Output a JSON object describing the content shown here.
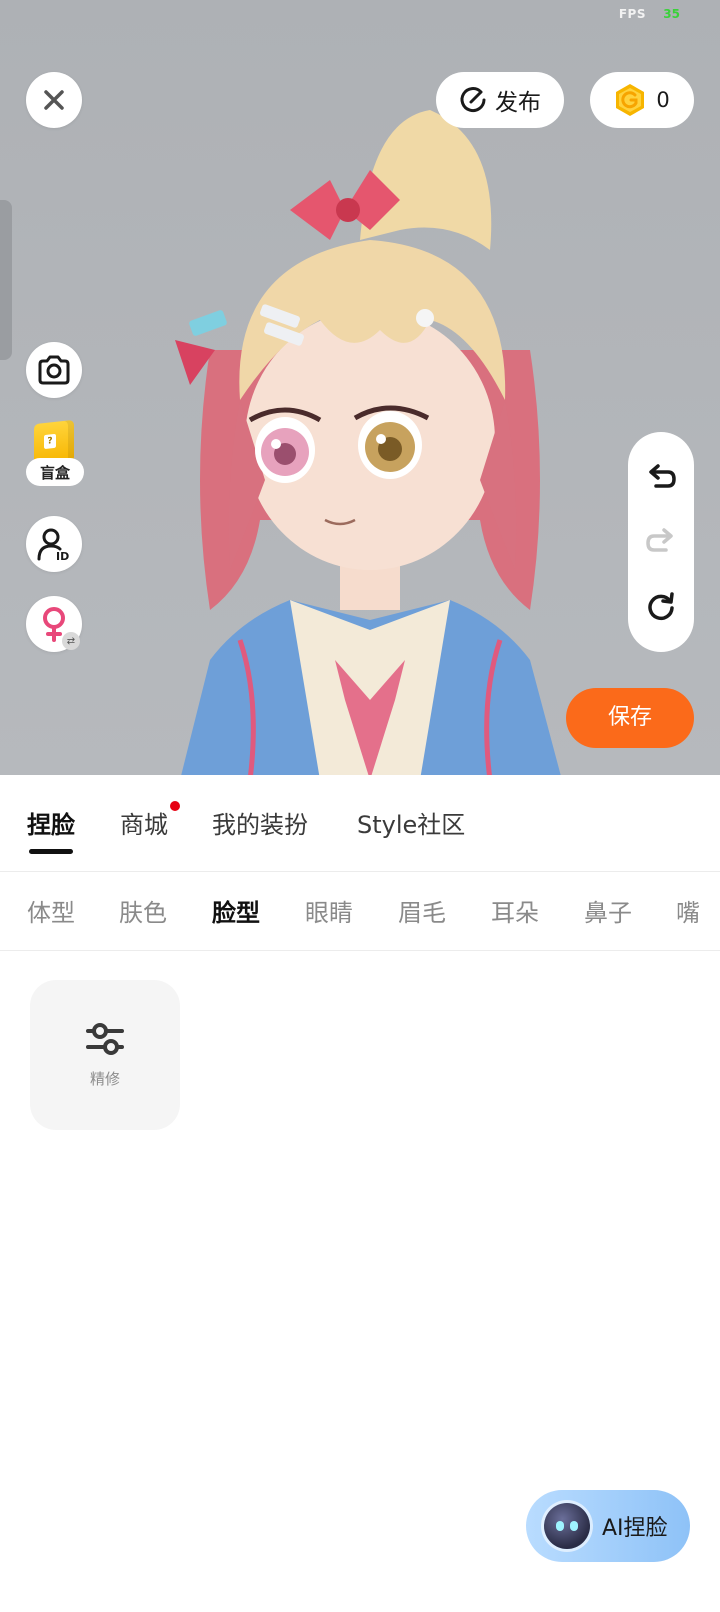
{
  "status": {
    "fps_label": "FPS",
    "fps_value": "35"
  },
  "top_bar": {
    "close_icon": "close-icon",
    "publish_label": "发布",
    "publish_icon": "publish-icon",
    "coin_count": "0",
    "coin_icon": "coin-icon"
  },
  "left_tools": {
    "camera_icon": "camera-icon",
    "blindbox_label": "盲盒",
    "id_icon": "user-id-icon",
    "gender_icon": "female-icon"
  },
  "history": {
    "undo_icon": "undo-icon",
    "redo_icon": "redo-icon",
    "reset_icon": "reset-icon"
  },
  "save_label": "保存",
  "main_tabs": [
    {
      "label": "捏脸",
      "active": true
    },
    {
      "label": "商城",
      "badge": true
    },
    {
      "label": "我的装扮"
    },
    {
      "label": "Style社区"
    }
  ],
  "sub_tabs": [
    {
      "label": "体型"
    },
    {
      "label": "肤色"
    },
    {
      "label": "脸型",
      "active": true
    },
    {
      "label": "眼睛"
    },
    {
      "label": "眉毛"
    },
    {
      "label": "耳朵"
    },
    {
      "label": "鼻子"
    },
    {
      "label": "嘴"
    }
  ],
  "options": [
    {
      "label": "精修",
      "icon": "sliders-icon"
    }
  ],
  "ai_button": {
    "label": "AI捏脸",
    "icon": "ai-robot-icon"
  },
  "colors": {
    "save": "#fb6a1a",
    "coin": "#f7b500",
    "female": "#e8487a",
    "stage_bg": "#b3b6ba",
    "ai_btn": "#8ec2f7"
  }
}
